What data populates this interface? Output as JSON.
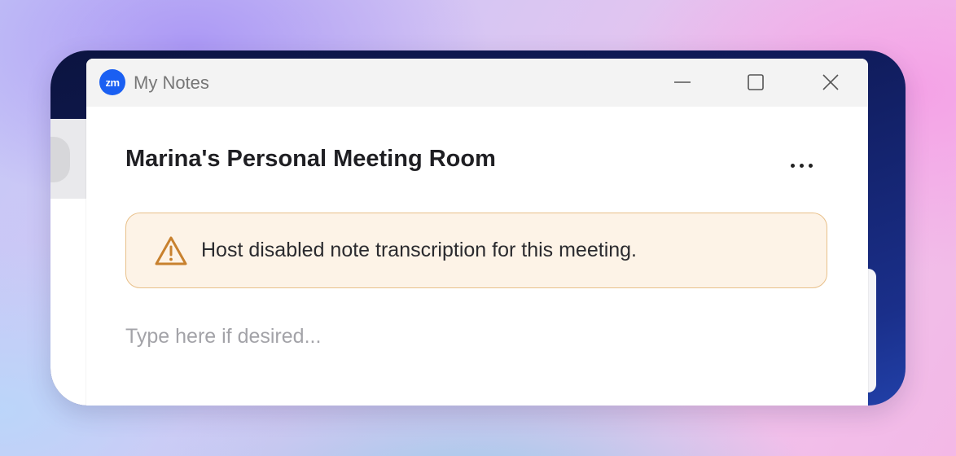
{
  "window": {
    "title": "My Notes",
    "logo_text": "zm",
    "controls": {
      "minimize_icon": "minimize-icon",
      "maximize_icon": "maximize-icon",
      "close_icon": "close-icon"
    }
  },
  "meeting": {
    "title": "Marina's Personal Meeting Room",
    "more_icon": "more-horizontal-icon"
  },
  "alert": {
    "icon": "warning-triangle-icon",
    "message": "Host disabled note transcription for this meeting.",
    "color_border": "#e8c08a",
    "color_background": "#fdf3e7",
    "color_icon": "#c8812f"
  },
  "notes": {
    "value": "",
    "placeholder": "Type here if desired..."
  },
  "colors": {
    "brand": "#1a5ff2"
  }
}
